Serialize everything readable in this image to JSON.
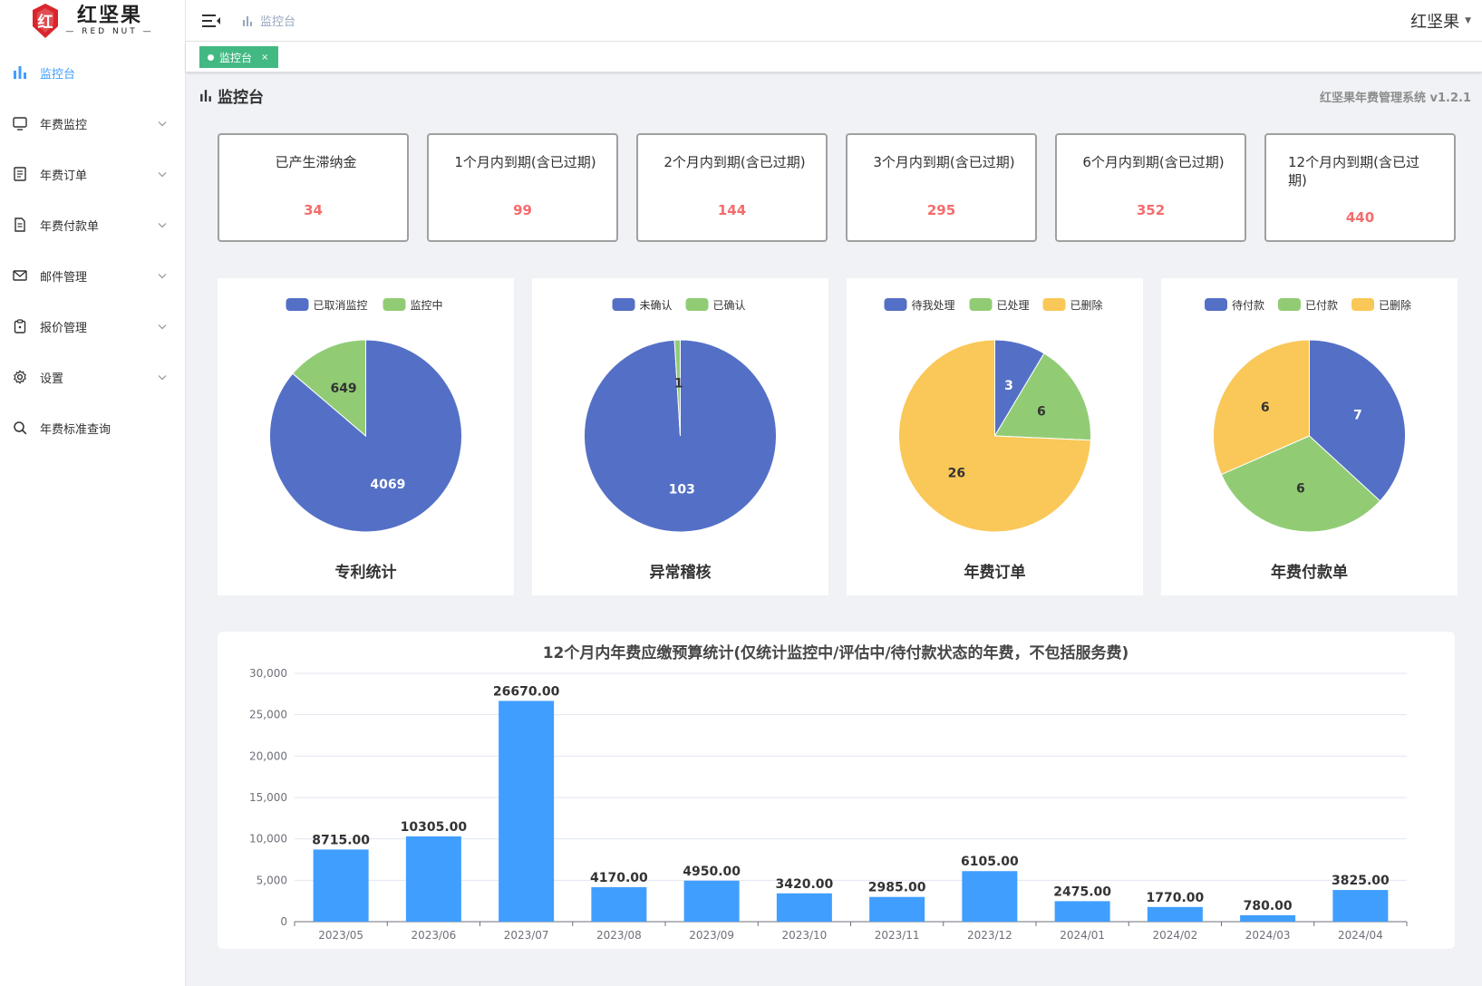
{
  "logo": {
    "cn": "红坚果",
    "en": "— RED NUT —",
    "mark": "红"
  },
  "sidebar": {
    "items": [
      {
        "label": "监控台",
        "icon": "bar-chart-icon",
        "active": true,
        "expandable": false
      },
      {
        "label": "年费监控",
        "icon": "monitor-icon",
        "active": false,
        "expandable": true
      },
      {
        "label": "年费订单",
        "icon": "document-list-icon",
        "active": false,
        "expandable": true
      },
      {
        "label": "年费付款单",
        "icon": "document-text-icon",
        "active": false,
        "expandable": true
      },
      {
        "label": "邮件管理",
        "icon": "mail-icon",
        "active": false,
        "expandable": true
      },
      {
        "label": "报价管理",
        "icon": "clipboard-icon",
        "active": false,
        "expandable": true
      },
      {
        "label": "设置",
        "icon": "gear-icon",
        "active": false,
        "expandable": true
      },
      {
        "label": "年费标准查询",
        "icon": "search-icon",
        "active": false,
        "expandable": false
      }
    ]
  },
  "header": {
    "breadcrumb": "监控台",
    "user": "红坚果"
  },
  "tags": [
    {
      "label": "监控台",
      "close": "×"
    }
  ],
  "page": {
    "title": "监控台",
    "version": "红坚果年费管理系统 v1.2.1"
  },
  "stats": [
    {
      "label": "已产生滞纳金",
      "value": "34"
    },
    {
      "label": "1个月内到期(含已过期)",
      "value": "99"
    },
    {
      "label": "2个月内到期(含已过期)",
      "value": "144"
    },
    {
      "label": "3个月内到期(含已过期)",
      "value": "295"
    },
    {
      "label": "6个月内到期(含已过期)",
      "value": "352"
    },
    {
      "label": "12个月内到期(含已过期)",
      "value": "440"
    }
  ],
  "colors": {
    "blue": "#5470c6",
    "green": "#91cc75",
    "yellow": "#fac858",
    "bar": "#409eff",
    "accent": "#409eff",
    "tag": "#42b983",
    "stat_value": "#f56c6c"
  },
  "chart_data": [
    {
      "type": "pie",
      "title": "专利统计",
      "categories": [
        "已取消监控",
        "监控中"
      ],
      "values": [
        4069,
        649
      ],
      "colors": [
        "#5470c6",
        "#91cc75"
      ]
    },
    {
      "type": "pie",
      "title": "异常稽核",
      "categories": [
        "未确认",
        "已确认"
      ],
      "values": [
        103,
        1
      ],
      "colors": [
        "#5470c6",
        "#91cc75"
      ]
    },
    {
      "type": "pie",
      "title": "年费订单",
      "categories": [
        "待我处理",
        "已处理",
        "已删除"
      ],
      "values": [
        3,
        6,
        26
      ],
      "colors": [
        "#5470c6",
        "#91cc75",
        "#fac858"
      ]
    },
    {
      "type": "pie",
      "title": "年费付款单",
      "categories": [
        "待付款",
        "已付款",
        "已删除"
      ],
      "values": [
        7,
        6,
        6
      ],
      "colors": [
        "#5470c6",
        "#91cc75",
        "#fac858"
      ]
    },
    {
      "type": "bar",
      "title": "12个月内年费应缴预算统计(仅统计监控中/评估中/待付款状态的年费，不包括服务费)",
      "categories": [
        "2023/05",
        "2023/06",
        "2023/07",
        "2023/08",
        "2023/09",
        "2023/10",
        "2023/11",
        "2023/12",
        "2024/01",
        "2024/02",
        "2024/03",
        "2024/04"
      ],
      "values": [
        8715.0,
        10305.0,
        26670.0,
        4170.0,
        4950.0,
        3420.0,
        2985.0,
        6105.0,
        2475.0,
        1770.0,
        780.0,
        3825.0
      ],
      "value_labels": [
        "8715.00",
        "10305.00",
        "26670.00",
        "4170.00",
        "4950.00",
        "3420.00",
        "2985.00",
        "6105.00",
        "2475.00",
        "1770.00",
        "780.00",
        "3825.00"
      ],
      "ylim": [
        0,
        30000
      ],
      "yticks": [
        0,
        5000,
        10000,
        15000,
        20000,
        25000,
        30000
      ],
      "ytick_labels": [
        "0",
        "5,000",
        "10,000",
        "15,000",
        "20,000",
        "25,000",
        "30,000"
      ],
      "grid": true
    }
  ]
}
